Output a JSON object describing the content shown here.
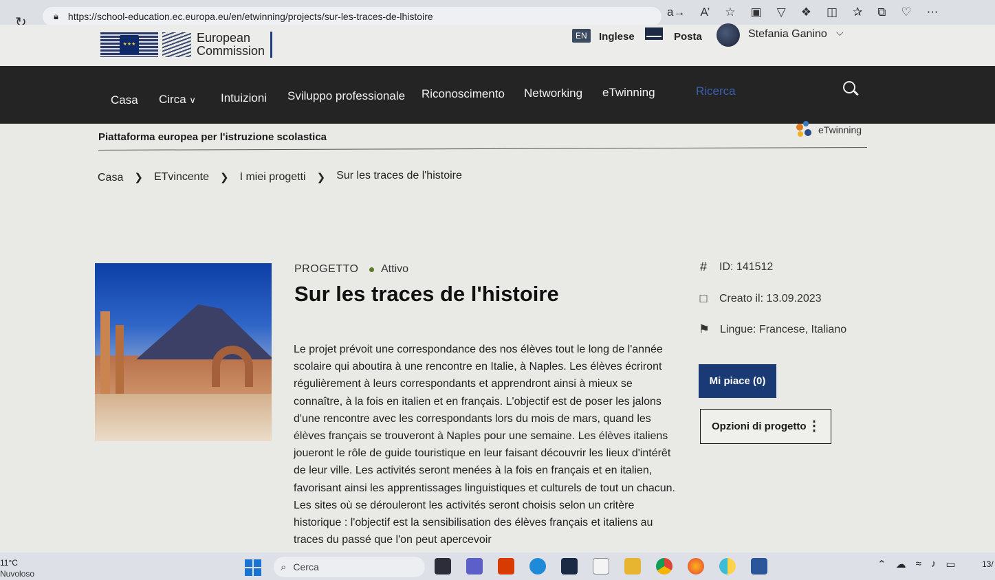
{
  "browser": {
    "url": "https://school-education.ec.europa.eu/en/etwinning/projects/sur-les-traces-de-lhistoire"
  },
  "header": {
    "logo_line1": "European",
    "logo_line2": "Commission",
    "lang_code": "EN",
    "lang_label": "Inglese",
    "mail_label": "Posta",
    "user_name": "Stefania Ganino"
  },
  "nav": {
    "items": [
      "Casa",
      "Circa",
      "Intuizioni",
      "Sviluppo professionale",
      "Riconoscimento",
      "Networking",
      "eTwinning",
      "Ricerca"
    ]
  },
  "platform": {
    "title": "Piattaforma europea per l'istruzione scolastica",
    "brand": "eTwinning"
  },
  "breadcrumb": [
    "Casa",
    "ETvincente",
    "I miei progetti",
    "Sur les traces de l'histoire"
  ],
  "project": {
    "kind": "PROGETTO",
    "status": "Attivo",
    "title": "Sur les traces de l'histoire",
    "description": "Le projet prévoit une correspondance des nos élèves tout le long de l'année scolaire qui aboutira à une rencontre en Italie, à Naples. Les élèves écriront régulièrement à leurs correspondants et apprendront ainsi à mieux se connaître, à la fois en italien et en français. L'objectif est de poser les jalons d'une rencontre avec les correspondants lors du mois de mars, quand les élèves français se trouveront à Naples pour une semaine. Les élèves italiens joueront le rôle de guide touristique en leur faisant découvrir les lieux d'intérêt de leur ville. Les activités seront menées à la fois en français et en italien, favorisant ainsi les apprentissages linguistiques et culturels de tout un chacun. Les sites où se dérouleront les activités seront choisis selon un critère historique : l'objectif est la sensibilisation des élèves français et italiens au traces du passé que l'on peut apercevoir",
    "id_label": "ID: 141512",
    "created_label": "Creato il: 13.09.2023",
    "languages_label": "Lingue: Francese, Italiano",
    "like_label": "Mi piace (0)",
    "options_label": "Opzioni di progetto"
  },
  "taskbar": {
    "temperature": "11°C",
    "weather": "Nuvoloso",
    "search_placeholder": "Cerca",
    "clock": "13/"
  },
  "colors": {
    "nav_bg": "#242424",
    "like_button": "#1a3a75",
    "search_nav_dim": "#3b5fb0"
  }
}
